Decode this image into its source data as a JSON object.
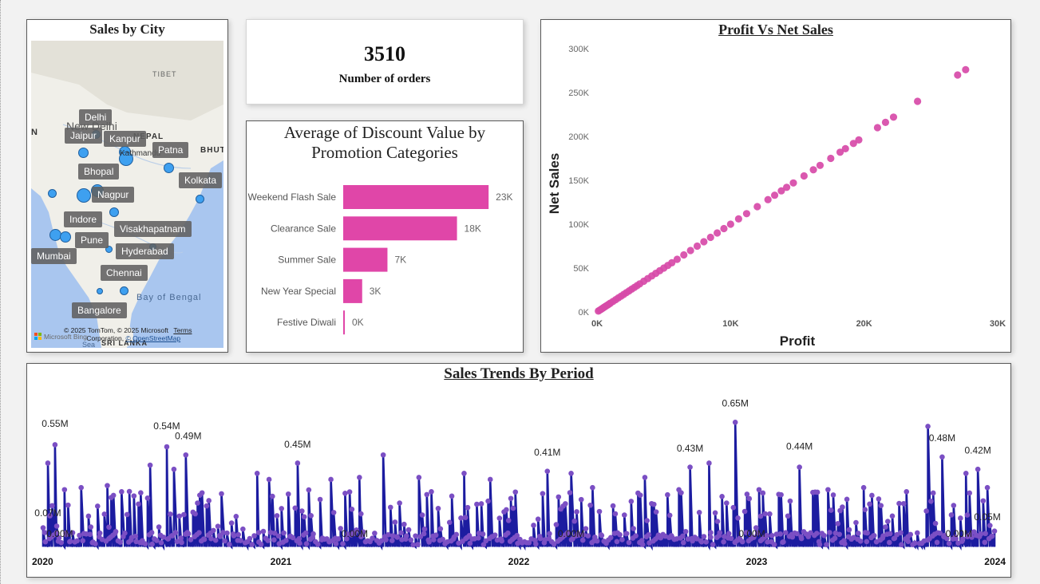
{
  "map": {
    "title": "Sales by City",
    "cities": [
      {
        "name": "Delhi"
      },
      {
        "name": "Jaipur"
      },
      {
        "name": "Kanpur"
      },
      {
        "name": "Patna"
      },
      {
        "name": "Bhopal"
      },
      {
        "name": "Kolkata"
      },
      {
        "name": "Nagpur"
      },
      {
        "name": "Indore"
      },
      {
        "name": "Visakhapatnam"
      },
      {
        "name": "Pune"
      },
      {
        "name": "Mumbai"
      },
      {
        "name": "Hyderabad"
      },
      {
        "name": "Chennai"
      },
      {
        "name": "Bangalore"
      }
    ],
    "basemap_labels": {
      "tibet": "TIBET",
      "nepal": "NEPAL",
      "new_delhi": "New Delhi",
      "kathmandu": "Kathmandu",
      "bhutan": "BHUTAN",
      "bay": "Bay of Bengal",
      "sri_lanka": "SRI LANKA",
      "sea": "Sea",
      "n": "N"
    },
    "credits_line1": "© 2025 TomTom, © 2025 Microsoft",
    "credits_terms": "Terms",
    "credits_line2": "Corporation,",
    "credits_osm": "© OpenStreetMap",
    "ms_logo_text": "Microsoft Bing",
    "colors": {
      "bubble": "#3ea0f0",
      "water": "#a9c6ef",
      "land": "#f0efe9"
    }
  },
  "card": {
    "value": "3510",
    "label": "Number of orders"
  },
  "discount_chart": {
    "title_line1": "Average of Discount Value by",
    "title_line2": "Promotion Categories",
    "chart_data": {
      "type": "bar",
      "orientation": "horizontal",
      "categories": [
        "Weekend Flash Sale",
        "Clearance Sale",
        "Summer Sale",
        "New Year Special",
        "Festive Diwali"
      ],
      "values": [
        23000,
        18000,
        7000,
        3000,
        200
      ],
      "labels": [
        "23K",
        "18K",
        "7K",
        "3K",
        "0K"
      ],
      "xlim": [
        0,
        25000
      ],
      "color": "#e046a8"
    }
  },
  "scatter_chart": {
    "title": "Profit Vs Net Sales",
    "chart_data": {
      "type": "scatter",
      "xlabel": "Profit",
      "ylabel": "Net Sales",
      "xlim": [
        0,
        30000
      ],
      "ylim": [
        0,
        300000
      ],
      "x_ticks": [
        "0K",
        "10K",
        "20K",
        "30K"
      ],
      "y_ticks": [
        "0K",
        "50K",
        "100K",
        "150K",
        "200K",
        "250K",
        "300K"
      ],
      "color": "#d74aa8",
      "x": [
        100,
        200,
        300,
        400,
        500,
        600,
        700,
        800,
        900,
        1000,
        1200,
        1400,
        1600,
        1800,
        2000,
        2200,
        2400,
        2600,
        2800,
        3000,
        3200,
        3500,
        3800,
        4100,
        4400,
        4700,
        5000,
        5300,
        5600,
        6000,
        6500,
        7000,
        7500,
        8000,
        8500,
        9000,
        9500,
        10000,
        10600,
        11200,
        12000,
        12800,
        13300,
        13800,
        14200,
        14700,
        15500,
        16200,
        16700,
        17500,
        18200,
        18600,
        19200,
        19600,
        21000,
        21600,
        22200,
        24000,
        27000,
        27600
      ],
      "y": [
        1000,
        2000,
        3000,
        4000,
        5000,
        6000,
        7000,
        8000,
        9000,
        10000,
        12000,
        14000,
        16000,
        18000,
        20000,
        22000,
        24000,
        26000,
        28000,
        30000,
        32000,
        35000,
        38000,
        41000,
        44000,
        47000,
        50000,
        53000,
        56000,
        60000,
        65000,
        70000,
        75000,
        80000,
        85000,
        90000,
        95000,
        100000,
        106000,
        112000,
        120000,
        128000,
        133000,
        138000,
        142000,
        147000,
        155000,
        162000,
        167000,
        175000,
        182000,
        186000,
        192000,
        196000,
        210000,
        216000,
        222000,
        240000,
        270000,
        276000
      ]
    }
  },
  "trend_chart": {
    "title": "Sales Trends By Period",
    "chart_data": {
      "type": "line",
      "x_ticks": [
        "2020",
        "2021",
        "2022",
        "2023",
        "2024"
      ],
      "xlim": [
        2020.0,
        2024.0
      ],
      "ylim": [
        0,
        0.75
      ],
      "unit": "M",
      "line_color": "#1c1ca0",
      "marker_color": "#7b4fc4",
      "annotations": [
        {
          "x": 2020.05,
          "y": 0.55,
          "label": "0.55M"
        },
        {
          "x": 2020.02,
          "y": 0.07,
          "label": "0.07M"
        },
        {
          "x": 2020.07,
          "y": 0.0,
          "label": "0.00M"
        },
        {
          "x": 2020.52,
          "y": 0.54,
          "label": "0.54M"
        },
        {
          "x": 2020.61,
          "y": 0.49,
          "label": "0.49M"
        },
        {
          "x": 2021.07,
          "y": 0.45,
          "label": "0.45M"
        },
        {
          "x": 2021.31,
          "y": 0.0,
          "label": "0.00M"
        },
        {
          "x": 2022.12,
          "y": 0.41,
          "label": "0.41M"
        },
        {
          "x": 2022.22,
          "y": 0.0,
          "label": "0.00M"
        },
        {
          "x": 2022.72,
          "y": 0.43,
          "label": "0.43M"
        },
        {
          "x": 2022.91,
          "y": 0.65,
          "label": "0.65M"
        },
        {
          "x": 2022.98,
          "y": 0.0,
          "label": "0.00M"
        },
        {
          "x": 2023.18,
          "y": 0.44,
          "label": "0.44M"
        },
        {
          "x": 2023.78,
          "y": 0.48,
          "label": "0.48M"
        },
        {
          "x": 2023.85,
          "y": 0.0,
          "label": "0.00M"
        },
        {
          "x": 2023.93,
          "y": 0.42,
          "label": "0.42M"
        },
        {
          "x": 2023.97,
          "y": 0.05,
          "label": "0.05M"
        }
      ],
      "peaks": [
        {
          "x": 2020.02,
          "y": 0.42
        },
        {
          "x": 2020.05,
          "y": 0.51
        },
        {
          "x": 2020.09,
          "y": 0.29
        },
        {
          "x": 2020.16,
          "y": 0.3
        },
        {
          "x": 2020.27,
          "y": 0.31
        },
        {
          "x": 2020.33,
          "y": 0.28
        },
        {
          "x": 2020.45,
          "y": 0.41
        },
        {
          "x": 2020.52,
          "y": 0.5
        },
        {
          "x": 2020.55,
          "y": 0.39
        },
        {
          "x": 2020.6,
          "y": 0.46
        },
        {
          "x": 2020.75,
          "y": 0.27
        },
        {
          "x": 2020.9,
          "y": 0.37
        },
        {
          "x": 2020.95,
          "y": 0.34
        },
        {
          "x": 2021.07,
          "y": 0.42
        },
        {
          "x": 2021.21,
          "y": 0.34
        },
        {
          "x": 2021.33,
          "y": 0.35
        },
        {
          "x": 2021.43,
          "y": 0.46
        },
        {
          "x": 2021.58,
          "y": 0.35
        },
        {
          "x": 2021.77,
          "y": 0.37
        },
        {
          "x": 2021.88,
          "y": 0.34
        },
        {
          "x": 2022.12,
          "y": 0.38
        },
        {
          "x": 2022.22,
          "y": 0.37
        },
        {
          "x": 2022.31,
          "y": 0.3
        },
        {
          "x": 2022.53,
          "y": 0.35
        },
        {
          "x": 2022.72,
          "y": 0.4
        },
        {
          "x": 2022.8,
          "y": 0.42
        },
        {
          "x": 2022.91,
          "y": 0.62
        },
        {
          "x": 2023.01,
          "y": 0.29
        },
        {
          "x": 2023.18,
          "y": 0.4
        },
        {
          "x": 2023.3,
          "y": 0.29
        },
        {
          "x": 2023.45,
          "y": 0.3
        },
        {
          "x": 2023.63,
          "y": 0.28
        },
        {
          "x": 2023.72,
          "y": 0.6
        },
        {
          "x": 2023.78,
          "y": 0.45
        },
        {
          "x": 2023.88,
          "y": 0.37
        },
        {
          "x": 2023.93,
          "y": 0.39
        },
        {
          "x": 2023.97,
          "y": 0.3
        }
      ]
    }
  }
}
